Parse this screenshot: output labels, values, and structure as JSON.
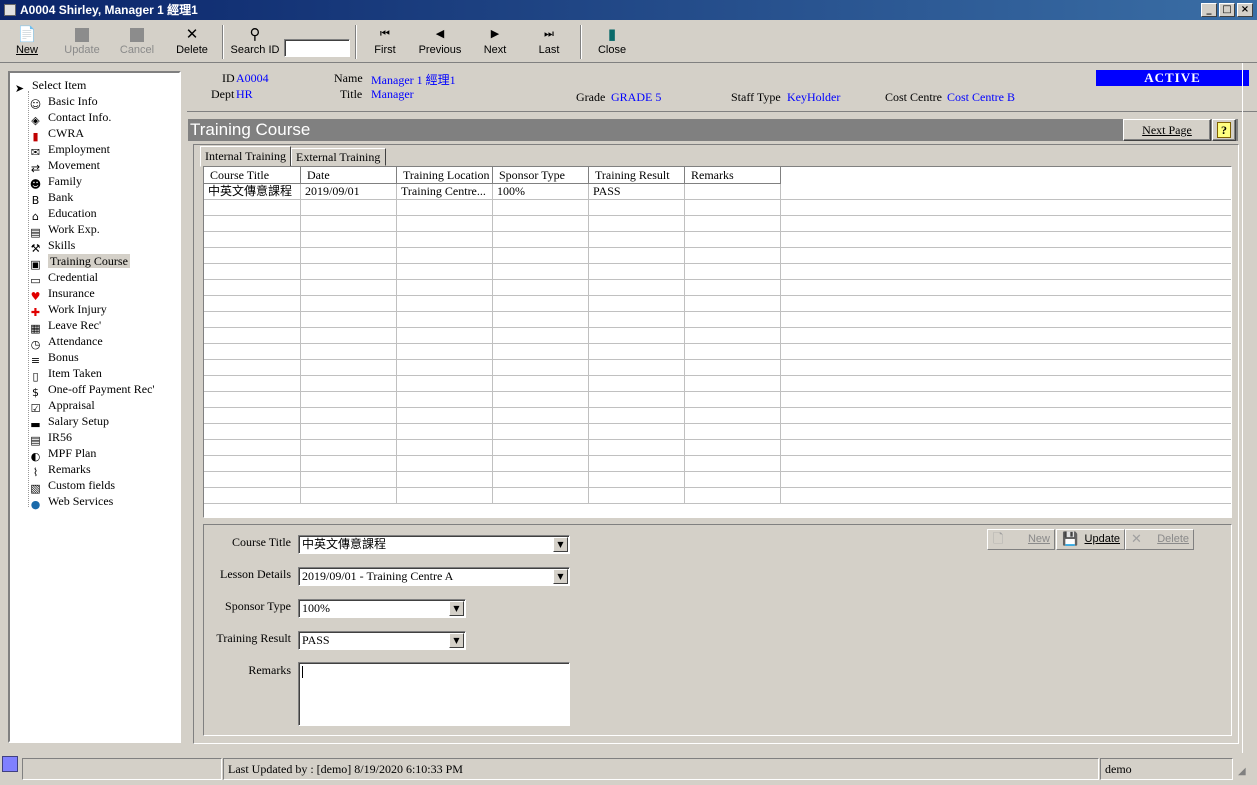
{
  "window": {
    "title": "A0004 Shirley, Manager 1 經理1"
  },
  "toolbar": {
    "new": "New",
    "update": "Update",
    "cancel": "Cancel",
    "delete": "Delete",
    "search_id": "Search ID",
    "first": "First",
    "previous": "Previous",
    "next": "Next",
    "last": "Last",
    "close": "Close"
  },
  "sidebar": {
    "items": [
      {
        "label": "Select Item",
        "icon": "pointer-icon"
      },
      {
        "label": "Basic Info",
        "icon": "person-icon"
      },
      {
        "label": "Contact Info.",
        "icon": "address-icon"
      },
      {
        "label": "CWRA",
        "icon": "book-icon"
      },
      {
        "label": "Employment",
        "icon": "envelope-icon"
      },
      {
        "label": "Movement",
        "icon": "movement-icon"
      },
      {
        "label": "Family",
        "icon": "family-icon"
      },
      {
        "label": "Bank",
        "icon": "bank-icon"
      },
      {
        "label": "Education",
        "icon": "education-icon"
      },
      {
        "label": "Work Exp.",
        "icon": "document-icon"
      },
      {
        "label": "Skills",
        "icon": "wrench-icon"
      },
      {
        "label": "Training Course",
        "icon": "training-icon"
      },
      {
        "label": "Credential",
        "icon": "credential-icon"
      },
      {
        "label": "Insurance",
        "icon": "heart-icon"
      },
      {
        "label": "Work Injury",
        "icon": "cross-icon"
      },
      {
        "label": "Leave Rec'",
        "icon": "calendar-icon"
      },
      {
        "label": "Attendance",
        "icon": "clock-icon"
      },
      {
        "label": "Bonus",
        "icon": "bonus-icon"
      },
      {
        "label": "Item Taken",
        "icon": "item-icon"
      },
      {
        "label": "One-off Payment Rec'",
        "icon": "dollar-icon"
      },
      {
        "label": "Appraisal",
        "icon": "checklist-icon"
      },
      {
        "label": "Salary Setup",
        "icon": "salary-icon"
      },
      {
        "label": "IR56",
        "icon": "form-icon"
      },
      {
        "label": "MPF Plan",
        "icon": "mpf-icon"
      },
      {
        "label": "Remarks",
        "icon": "paperclip-icon"
      },
      {
        "label": "Custom fields",
        "icon": "custom-icon"
      },
      {
        "label": "Web Services",
        "icon": "globe-icon"
      }
    ]
  },
  "header": {
    "id_label": "ID",
    "id_value": "A0004",
    "dept_label": "Dept",
    "dept_value": "HR",
    "name_label": "Name",
    "name_value": "Manager 1  經理1",
    "title_label": "Title",
    "title_value": "Manager",
    "grade_label": "Grade",
    "grade_value": "GRADE 5",
    "staff_type_label": "Staff Type",
    "staff_type_value": "KeyHolder",
    "cost_centre_label": "Cost Centre",
    "cost_centre_value": "Cost Centre B",
    "status": "ACTIVE"
  },
  "section": {
    "title": "Training Course",
    "next_page": "Next Page",
    "help": "?"
  },
  "tabs": [
    "Internal Training",
    "External Training"
  ],
  "grid": {
    "columns": [
      "Course Title",
      "Date",
      "Training Location",
      "Sponsor Type",
      "Training Result",
      "Remarks"
    ],
    "rows": [
      [
        "中英文傳意課程",
        "2019/09/01",
        "Training Centre...",
        "100%",
        "PASS",
        ""
      ]
    ]
  },
  "form": {
    "course_title_label": "Course Title",
    "course_title_value": "中英文傳意課程",
    "lesson_details_label": "Lesson Details",
    "lesson_details_value": "2019/09/01 - Training Centre A",
    "sponsor_type_label": "Sponsor Type",
    "sponsor_type_value": "100%",
    "training_result_label": "Training Result",
    "training_result_value": "PASS",
    "remarks_label": "Remarks",
    "new": "New",
    "update": "Update",
    "delete": "Delete"
  },
  "statusbar": {
    "last_updated": "Last Updated by : [demo]  8/19/2020 6:10:33 PM",
    "user": "demo"
  },
  "colors": {
    "active_bg": "#0000ff",
    "value_text": "#0000ff",
    "section_bar": "#808080"
  }
}
